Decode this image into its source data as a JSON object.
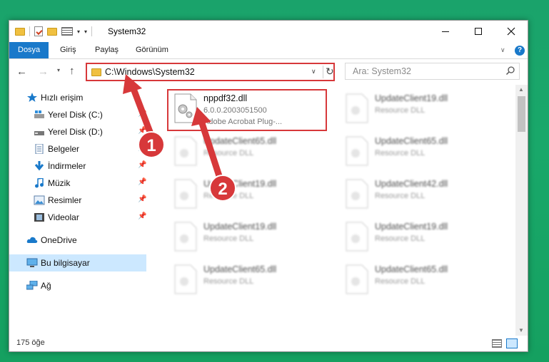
{
  "window": {
    "title": "System32"
  },
  "ribbon": {
    "tabs": [
      {
        "label": "Dosya",
        "active": true
      },
      {
        "label": "Giriş"
      },
      {
        "label": "Paylaş"
      },
      {
        "label": "Görünüm"
      }
    ],
    "help_label": "?"
  },
  "address": {
    "path": "C:\\Windows\\System32"
  },
  "search": {
    "placeholder": "Ara: System32"
  },
  "sidebar": {
    "quick_access": "Hızlı erişim",
    "items": [
      {
        "label": "Yerel Disk (C:)",
        "icon": "drive-icon",
        "pinned": true
      },
      {
        "label": "Yerel Disk (D:)",
        "icon": "drive-icon",
        "pinned": true
      },
      {
        "label": "Belgeler",
        "icon": "documents-icon",
        "pinned": true
      },
      {
        "label": "İndirmeler",
        "icon": "download-icon",
        "pinned": true
      },
      {
        "label": "Müzik",
        "icon": "music-icon",
        "pinned": true
      },
      {
        "label": "Resimler",
        "icon": "pictures-icon",
        "pinned": true
      },
      {
        "label": "Videolar",
        "icon": "videos-icon",
        "pinned": true
      }
    ],
    "onedrive": "OneDrive",
    "this_pc": "Bu bilgisayar",
    "network": "Ağ"
  },
  "files": [
    {
      "name": "nppdf32.dll",
      "meta1": "6.0.0.2003051500",
      "meta2": "Adobe Acrobat Plug-...",
      "highlighted": true
    },
    {
      "name": "UpdateClient19.dll",
      "meta1": "Resource DLL"
    },
    {
      "name": "UpdateClient65.dll",
      "meta1": "Resource DLL"
    },
    {
      "name": "UpdateClient65.dll",
      "meta1": "Resource DLL"
    },
    {
      "name": "UpdateClient19.dll",
      "meta1": "Resource DLL"
    },
    {
      "name": "UpdateClient42.dll",
      "meta1": "Resource DLL"
    },
    {
      "name": "UpdateClient19.dll",
      "meta1": "Resource DLL"
    },
    {
      "name": "UpdateClient19.dll",
      "meta1": "Resource DLL"
    },
    {
      "name": "UpdateClient65.dll",
      "meta1": "Resource DLL"
    },
    {
      "name": "UpdateClient65.dll",
      "meta1": "Resource DLL"
    }
  ],
  "status": {
    "item_count": "175 öğe"
  },
  "annotations": {
    "step1": "1",
    "step2": "2",
    "color": "#d7383a"
  }
}
